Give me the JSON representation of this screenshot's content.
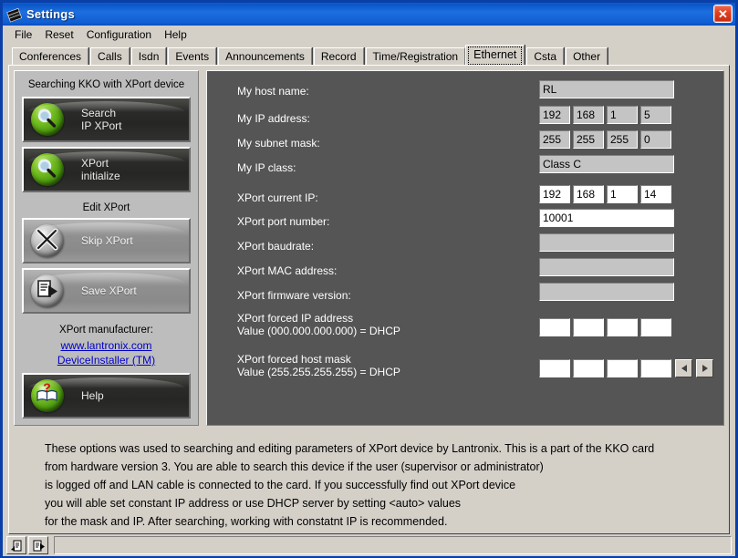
{
  "window": {
    "title": "Settings",
    "icon": "app-cards-icon",
    "close_label": "✕",
    "accent_titlebar": "#0f5ed2",
    "face_color": "#d4d0c8",
    "panel_dark": "#555555"
  },
  "menu": {
    "items": [
      "File",
      "Reset",
      "Configuration",
      "Help"
    ]
  },
  "tabs": {
    "items": [
      {
        "label": "Conferences",
        "selected": false
      },
      {
        "label": "Calls",
        "selected": false
      },
      {
        "label": "Isdn",
        "selected": false
      },
      {
        "label": "Events",
        "selected": false
      },
      {
        "label": "Announcements",
        "selected": false
      },
      {
        "label": "Record",
        "selected": false
      },
      {
        "label": "Time/Registration",
        "selected": false
      },
      {
        "label": "Ethernet",
        "selected": true
      },
      {
        "label": "Csta",
        "selected": false
      },
      {
        "label": "Other",
        "selected": false
      }
    ]
  },
  "left_panel": {
    "search_caption": "Searching KKO\nwith XPort device",
    "buttons": [
      {
        "label": "Search\nIP XPort",
        "icon": "magnifier-green-sphere-icon",
        "enabled": true
      },
      {
        "label": "XPort\ninitialize",
        "icon": "magnifier-green-sphere-icon",
        "enabled": true
      }
    ],
    "edit_caption": "Edit XPort",
    "edit_buttons": [
      {
        "label": "Skip XPort",
        "icon": "x-gray-sphere-icon",
        "enabled": false
      },
      {
        "label": "Save XPort",
        "icon": "save-document-gray-sphere-icon",
        "enabled": false
      }
    ],
    "manufacturer_caption": "XPort manufacturer:",
    "links": [
      {
        "label": "www.lantronix.com"
      },
      {
        "label": "DeviceInstaller (TM)"
      }
    ],
    "help_button": {
      "label": "Help",
      "icon": "help-book-green-sphere-icon",
      "enabled": true
    },
    "link_color": "#0000c8"
  },
  "form": {
    "host_name": {
      "label": "My host name:",
      "value": "RL",
      "readonly": true
    },
    "ip_address": {
      "label": "My IP address:",
      "octets": [
        "192",
        "168",
        "1",
        "5"
      ],
      "readonly": true
    },
    "subnet_mask": {
      "label": "My subnet mask:",
      "octets": [
        "255",
        "255",
        "255",
        "0"
      ],
      "readonly": true
    },
    "ip_class": {
      "label": "My IP class:",
      "value": "Class C",
      "readonly": true
    },
    "xport_current_ip": {
      "label": "XPort current IP:",
      "octets": [
        "192",
        "168",
        "1",
        "14"
      ],
      "readonly": false
    },
    "xport_port_number": {
      "label": "XPort port number:",
      "value": "10001",
      "readonly": false
    },
    "xport_baudrate": {
      "label": "XPort baudrate:",
      "value": "",
      "readonly": true
    },
    "xport_mac_address": {
      "label": "XPort MAC address:",
      "value": "",
      "readonly": true
    },
    "xport_firmware_version": {
      "label": "XPort firmware version:",
      "value": "",
      "readonly": true
    },
    "xport_forced_ip": {
      "label": "XPort forced IP address\nValue (000.000.000.000) = DHCP",
      "octets": [
        "",
        "",
        "",
        ""
      ],
      "readonly": false
    },
    "xport_forced_mask": {
      "label": "XPort forced host mask\nValue (255.255.255.255) = DHCP",
      "octets": [
        "",
        "",
        "",
        ""
      ],
      "readonly": false
    },
    "spinner_prev": "◀",
    "spinner_next": "▶"
  },
  "description": {
    "lines": [
      "These options was used to searching and editing parameters of XPort device by Lantronix. This is a part of the KKO card",
      "from hardware version 3. You are able to search this device if the user (supervisor or administrator)",
      "is logged off and LAN cable is connected to the card. If you successfully find out XPort device",
      "you will able set constant IP address or use DHCP server by setting <auto> values",
      "for the mask and IP. After searching, working with constatnt IP is recommended."
    ]
  },
  "statusbar": {
    "buttons": [
      {
        "icon": "document-lock-icon"
      },
      {
        "icon": "document-arrow-icon"
      }
    ],
    "message": ""
  }
}
